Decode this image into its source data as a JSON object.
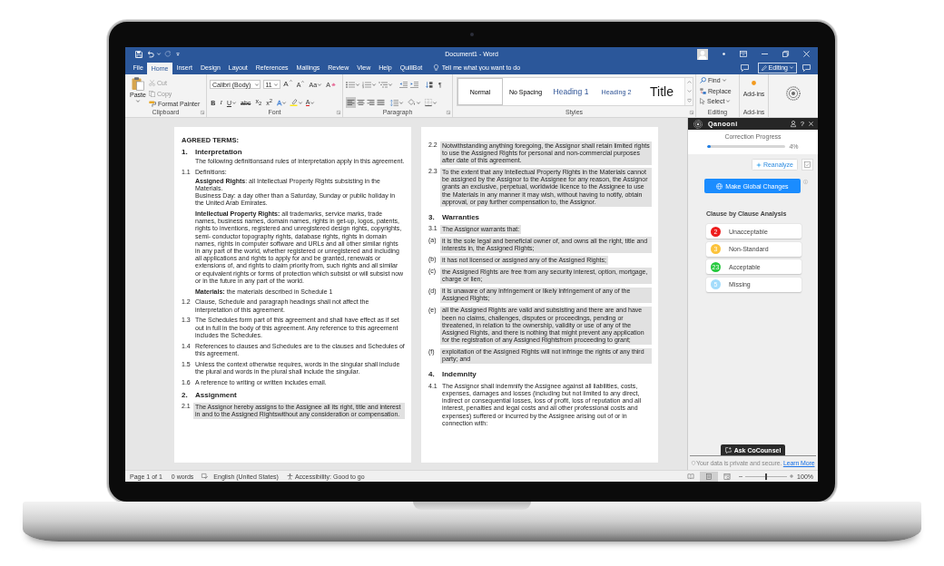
{
  "window": {
    "title": "Document1 - Word"
  },
  "tabs": [
    {
      "label": "File",
      "selected": false
    },
    {
      "label": "Home",
      "selected": true
    },
    {
      "label": "Insert",
      "selected": false
    },
    {
      "label": "Design",
      "selected": false
    },
    {
      "label": "Layout",
      "selected": false
    },
    {
      "label": "References",
      "selected": false
    },
    {
      "label": "Mailings",
      "selected": false
    },
    {
      "label": "Review",
      "selected": false
    },
    {
      "label": "View",
      "selected": false
    },
    {
      "label": "Help",
      "selected": false
    },
    {
      "label": "QuillBot",
      "selected": false
    }
  ],
  "tell_me": {
    "placeholder": "Tell me what you want to do"
  },
  "mode_button": {
    "label": "Editing"
  },
  "ribbon": {
    "clipboard": {
      "paste": "Paste",
      "items": [
        {
          "kind": "cut",
          "label": "Cut",
          "disabled": true
        },
        {
          "kind": "copy",
          "label": "Copy",
          "disabled": true
        },
        {
          "kind": "painter",
          "label": "Format Painter",
          "disabled": false
        }
      ],
      "label": "Clipboard"
    },
    "font": {
      "name": "Calibri (Body)",
      "size": "11",
      "tools": [
        {
          "kind": "grow",
          "label": "A"
        },
        {
          "kind": "shrink",
          "label": "A"
        },
        {
          "kind": "case",
          "label": "Aa"
        },
        {
          "kind": "clear",
          "label": "A"
        }
      ],
      "format": [
        {
          "kind": "bold",
          "label": "B"
        },
        {
          "kind": "italic",
          "label": "I"
        },
        {
          "kind": "underline",
          "label": "U"
        },
        {
          "kind": "strike",
          "label": "abc"
        },
        {
          "kind": "sub",
          "label": "x$_{2}$"
        },
        {
          "kind": "sup",
          "label": "x$^{2}$"
        },
        {
          "kind": "effects",
          "label": "A"
        },
        {
          "kind": "color",
          "label": "A"
        }
      ],
      "label": "Font"
    },
    "paragraph": {
      "marks": "¶",
      "align": [
        {
          "kind": "left",
          "selected": true
        },
        {
          "kind": "center",
          "selected": false
        },
        {
          "kind": "right",
          "selected": false
        },
        {
          "kind": "justify",
          "selected": false
        }
      ],
      "label": "Paragraph"
    },
    "styles": {
      "items": [
        {
          "kind": "normal",
          "label": "Normal",
          "selected": true
        },
        {
          "kind": "plain",
          "label": "No Spacing",
          "selected": false
        },
        {
          "kind": "heading1",
          "label": "Heading 1",
          "selected": false
        },
        {
          "kind": "heading2",
          "label": "Heading 2",
          "selected": false
        },
        {
          "kind": "title",
          "label": "Title",
          "selected": false
        }
      ],
      "label": "Styles"
    },
    "editing": {
      "items": [
        {
          "kind": "find",
          "label": "Find"
        },
        {
          "kind": "replace",
          "label": "Replace"
        },
        {
          "kind": "select",
          "label": "Select"
        }
      ],
      "label": "Editing"
    },
    "addins": {
      "button": "Add-ins",
      "label": "Add-ins"
    }
  },
  "document": {
    "pages": [
      {
        "blocks": [
          {
            "kind": "title",
            "text": "AGREED TERMS:"
          },
          {
            "kind": "heading",
            "number": "1.",
            "text": "Interpretation"
          },
          {
            "kind": "clause",
            "lines": [
              "The following definitionsand rules of interpretation apply in this agreement."
            ],
            "highlighted": false
          },
          {
            "kind": "clause",
            "number": "1.1",
            "lines": [
              "Definitions:"
            ],
            "highlighted": false,
            "children": [
              {
                "lines": [
                  "**Assigned Rights**: all Intellectual Property Rights subsisting in the Materials.",
                  "Business Day: a day other than a Saturday, Sunday or public holiday in the United Arab Emirates."
                ],
                "highlighted": false
              },
              {
                "lines": [
                  "**Intellectual Property Rights:** all trademarks, service marks, trade names, business names, domain names, rights in get-up, logos, patents, rights to inventions, registered and unregistered design rights, copyrights, semi- conductor topography rights, database rights, rights in domain names, rights in computer software and URLs and all other similar rights in any part of the world, whether registered or unregistered and including all applications and rights to apply for and be granted, renewals or extensions of, and rights to claim priority from, such rights and all similar or equivalent rights or forms of protection which subsist or will subsist now or in the future in any part of the world."
                ],
                "highlighted": false
              },
              {
                "lines": [
                  "**Materials:** the materials described in Schedule 1"
                ],
                "highlighted": false
              }
            ]
          },
          {
            "kind": "clause",
            "number": "1.2",
            "lines": [
              "Clause, Schedule and paragraph headings shall not affect the interpretation of this agreement."
            ],
            "highlighted": false
          },
          {
            "kind": "clause",
            "number": "1.3",
            "lines": [
              "The Schedules form part of this agreement and shall have effect as if set out in full in the body of this agreement. Any reference to this agreement includes the Schedules."
            ],
            "highlighted": false
          },
          {
            "kind": "clause",
            "number": "1.4",
            "lines": [
              "References to clauses and Schedules are to the clauses and Schedules of this agreement."
            ],
            "highlighted": false
          },
          {
            "kind": "clause",
            "number": "1.5",
            "lines": [
              "Unless the context otherwise requires, words in the singular shall include the plural and words in the plural shall include the singular."
            ],
            "highlighted": false
          },
          {
            "kind": "clause",
            "number": "1.6",
            "lines": [
              "A reference to writing or written includes email."
            ],
            "highlighted": false
          },
          {
            "kind": "heading",
            "number": "2.",
            "text": "Assignment"
          },
          {
            "kind": "clause",
            "number": "2.1",
            "lines": [
              "The Assignor hereby assigns to the Assignee all its right, title and interest in and to the Assigned Rightswithout any consideration or compensation."
            ],
            "highlighted": true
          }
        ]
      },
      {
        "blocks": [
          {
            "kind": "clause",
            "number": "2.2",
            "lines": [
              "Notwithstanding anything foregoing, the Assignor shall retain limited rights to use the Assigned Rights for personal and non-commercial purposes after date of this agreement."
            ],
            "highlighted": true
          },
          {
            "kind": "clause",
            "number": "2.3",
            "lines": [
              "To the extent that any Intellectual Property Rights in the Materials cannot be assigned by the Assignor to the Assignee for any reason, the Assignor grants an exclusive, perpetual, worldwide licence to the Assignee to use the Materials in any manner it may wish, without having to notify, obtain approval, or pay further compensation to, the Assignor."
            ],
            "highlighted": true
          },
          {
            "kind": "heading",
            "number": "3.",
            "text": "Warranties"
          },
          {
            "kind": "clause",
            "number": "3.1",
            "lines": [
              "The Assignor warrants that:"
            ],
            "highlighted": true
          },
          {
            "kind": "clause",
            "number": "(a)",
            "lines": [
              "it is the sole legal and beneficial owner of, and owns all the right, title and interests in, the Assigned Rights;"
            ],
            "highlighted": true
          },
          {
            "kind": "clause",
            "number": "(b)",
            "lines": [
              "it has not licensed or assigned any of the Assigned Rights;"
            ],
            "highlighted": true
          },
          {
            "kind": "clause",
            "number": "(c)",
            "lines": [
              "the Assigned Rights are free from any security interest, option, mortgage, charge or lien;"
            ],
            "highlighted": true
          },
          {
            "kind": "clause",
            "number": "(d)",
            "lines": [
              "it is unaware of any infringement or likely infringement of any of the Assigned Rights;"
            ],
            "highlighted": true
          },
          {
            "kind": "clause",
            "number": "(e)",
            "lines": [
              "all the Assigned Rights are valid and subsisting and there are and have been no claims, challenges, disputes or proceedings, pending or threatened, in relation to the ownership, validity or use of any of the Assigned Rights, and there is nothing that might prevent any application for the registration of any Assigned Rightsfrom proceeding to grant;"
            ],
            "highlighted": true
          },
          {
            "kind": "clause",
            "number": "(f)",
            "lines": [
              "exploitation of the Assigned Rights will not infringe the rights of any third party; and"
            ],
            "highlighted": true
          },
          {
            "kind": "heading",
            "number": "4.",
            "text": "Indemnity"
          },
          {
            "kind": "clause",
            "number": "4.1",
            "lines": [
              "The Assignor shall indemnify the Assignee against all liabilities, costs, expenses, damages and losses (including but not limited to any direct, indirect or consequential losses, loss of profit, loss of reputation and all interest, penalties and legal costs and all other professional costs and expenses) suffered or incurred by the Assignee arising out of or in connection with:"
            ],
            "highlighted": false
          }
        ]
      }
    ]
  },
  "sidebar": {
    "brand": "Qanooni",
    "help": "?",
    "progress": {
      "label": "Correction Progress",
      "level": 0.04,
      "reading": "4%"
    },
    "reanalyze": "Reanalyze",
    "global_button": "Make Global Changes",
    "section_title": "Clause by Clause Analysis",
    "categories": [
      {
        "count": "2",
        "label": "Unacceptable",
        "color": "#ee1c1c"
      },
      {
        "count": "3",
        "label": "Non-Standard",
        "color": "#fcc33c"
      },
      {
        "count": "23",
        "label": "Acceptable",
        "color": "#27c93f"
      },
      {
        "count": "5",
        "label": "Missing",
        "color": "#a3dcfb"
      }
    ],
    "ask_button": "Ask CoCounsel",
    "privacy": {
      "text": "Your data is private and secure.",
      "link": "Learn More"
    }
  },
  "status_bar": {
    "page": "Page 1 of 1",
    "words": "0 words",
    "language": "English (United States)",
    "accessibility": "Accessibility: Good to go",
    "views": [
      {
        "kind": "read",
        "selected": false
      },
      {
        "kind": "print",
        "selected": true
      },
      {
        "kind": "web",
        "selected": false
      }
    ],
    "zoom": {
      "level": 0.5,
      "reading": "100%"
    }
  }
}
